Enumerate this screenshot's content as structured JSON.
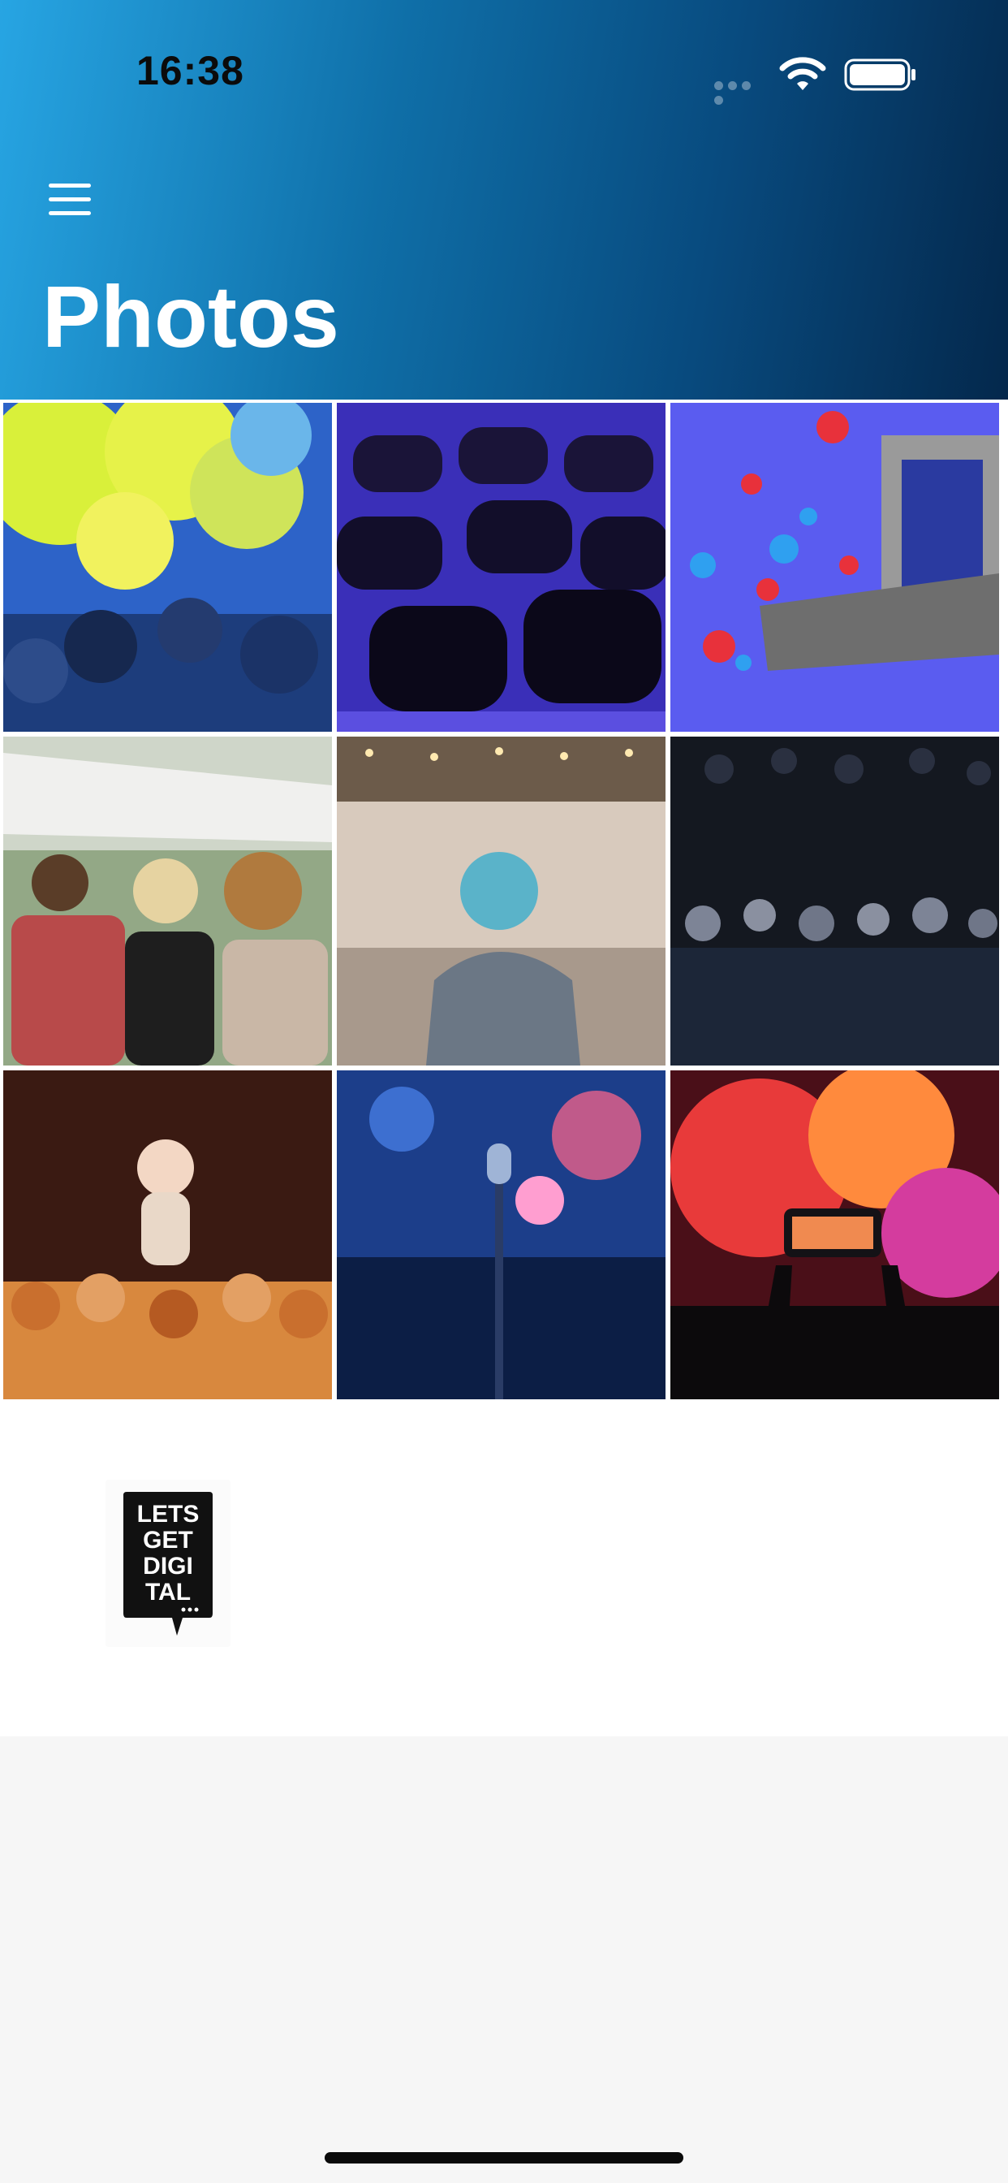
{
  "status_bar": {
    "time": "16:38"
  },
  "header": {
    "title": "Photos"
  },
  "photos": [
    {
      "subject": "colorful powder festival crowd"
    },
    {
      "subject": "rows of black chairs under blue light"
    },
    {
      "subject": "live stage with social reaction icons"
    },
    {
      "subject": "festival crowd from behind"
    },
    {
      "subject": "woman with blue hair in conference hall"
    },
    {
      "subject": "audience seated in dark venue"
    },
    {
      "subject": "performer crowd surfing over hands"
    },
    {
      "subject": "microphone stand with bokeh lights"
    },
    {
      "subject": "phone recording a concert"
    }
  ],
  "sponsor_logo": {
    "text": "LETS GET DIGI TAL ..."
  },
  "colors": {
    "header_start": "#27a5e3",
    "header_end": "#04284c",
    "accent_blue": "#3b66ff"
  }
}
